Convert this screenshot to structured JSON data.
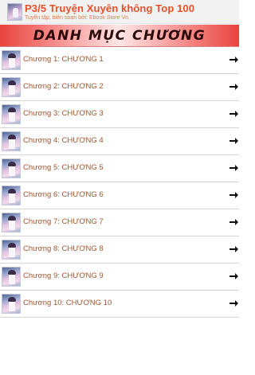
{
  "header": {
    "title": "P3/5 Truyện Xuyên không Top 100",
    "subtitle": "Tuyển tập, biên soạn bởi: Ebook Store Vn",
    "thumbnail_icon": "book-cover-icon"
  },
  "banner": {
    "title": "DANH MỤC CHƯƠNG"
  },
  "chapters": [
    {
      "label": "Chương 1: CHƯƠNG 1"
    },
    {
      "label": "Chương 2: CHƯƠNG 2"
    },
    {
      "label": "Chương 3: CHƯƠNG 3"
    },
    {
      "label": "Chương 4: CHƯƠNG 4"
    },
    {
      "label": "Chương 5: CHƯƠNG 5"
    },
    {
      "label": "Chương 6: CHƯƠNG 6"
    },
    {
      "label": "Chương 7: CHƯƠNG 7"
    },
    {
      "label": "Chương 8: CHƯƠNG 8"
    },
    {
      "label": "Chương 9: CHƯƠNG 9"
    },
    {
      "label": "Chương 10: CHƯƠNG 10"
    }
  ],
  "icons": {
    "chapter_thumbnail": "chapter-cover-icon",
    "chapter_arrow": "arrow-right-icon"
  },
  "colors": {
    "title": "#e8502a",
    "subtitle": "#e37a48",
    "chapter_text": "#a0552e",
    "banner_edge": "#e9433e",
    "banner_center": "#fde6e6"
  }
}
